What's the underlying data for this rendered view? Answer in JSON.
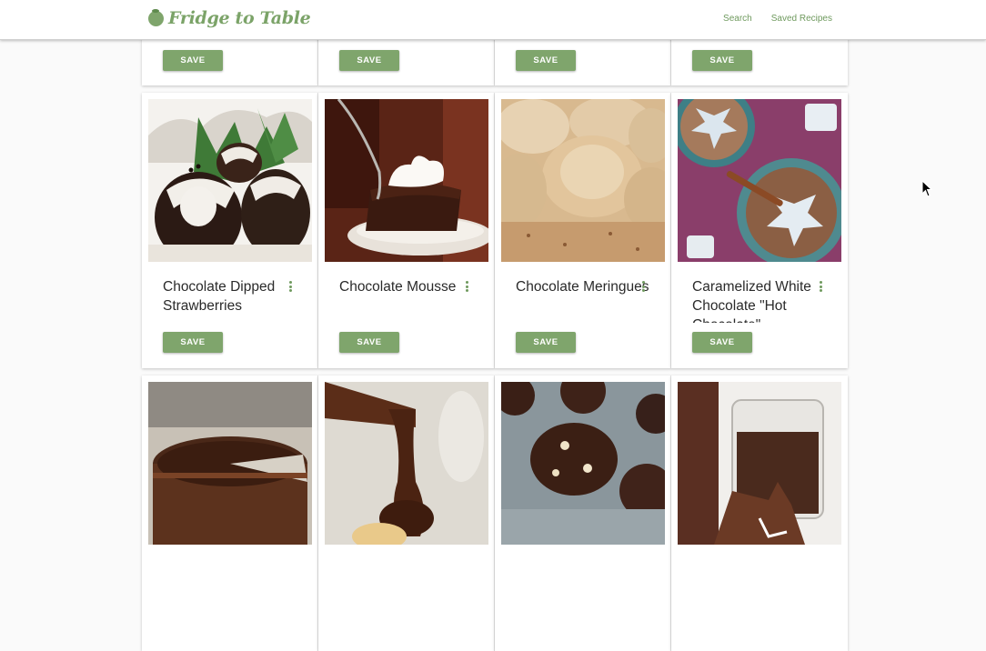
{
  "header": {
    "brand": "Fridge to Table",
    "nav": [
      {
        "label": "Search"
      },
      {
        "label": "Saved Recipes"
      }
    ]
  },
  "top_row": {
    "cards": [
      {
        "save_label": "SAVE"
      },
      {
        "save_label": "SAVE"
      },
      {
        "save_label": "SAVE"
      },
      {
        "save_label": "SAVE"
      }
    ]
  },
  "middle_row": {
    "cards": [
      {
        "title": "Chocolate Dipped Strawberries",
        "save_label": "SAVE",
        "image": "chocolate-dipped-strawberries-photo"
      },
      {
        "title": "Chocolate Mousse",
        "save_label": "SAVE",
        "image": "chocolate-mousse-photo"
      },
      {
        "title": "Chocolate Meringues",
        "save_label": "SAVE",
        "image": "chocolate-meringues-photo"
      },
      {
        "title": "Caramelized White Chocolate \"Hot Chocolate\"",
        "save_label": "SAVE",
        "image": "hot-chocolate-photo"
      }
    ]
  },
  "bottom_row": {
    "cards": [
      {
        "image": "chocolate-tart-photo"
      },
      {
        "image": "chocolate-sauce-pour-photo"
      },
      {
        "image": "chocolate-cookies-photo"
      },
      {
        "image": "hot-chocolate-glass-photo"
      }
    ]
  },
  "colors": {
    "accent": "#7fa56c",
    "brand_text": "#7ba368",
    "nav_link": "#6f9a5e"
  }
}
